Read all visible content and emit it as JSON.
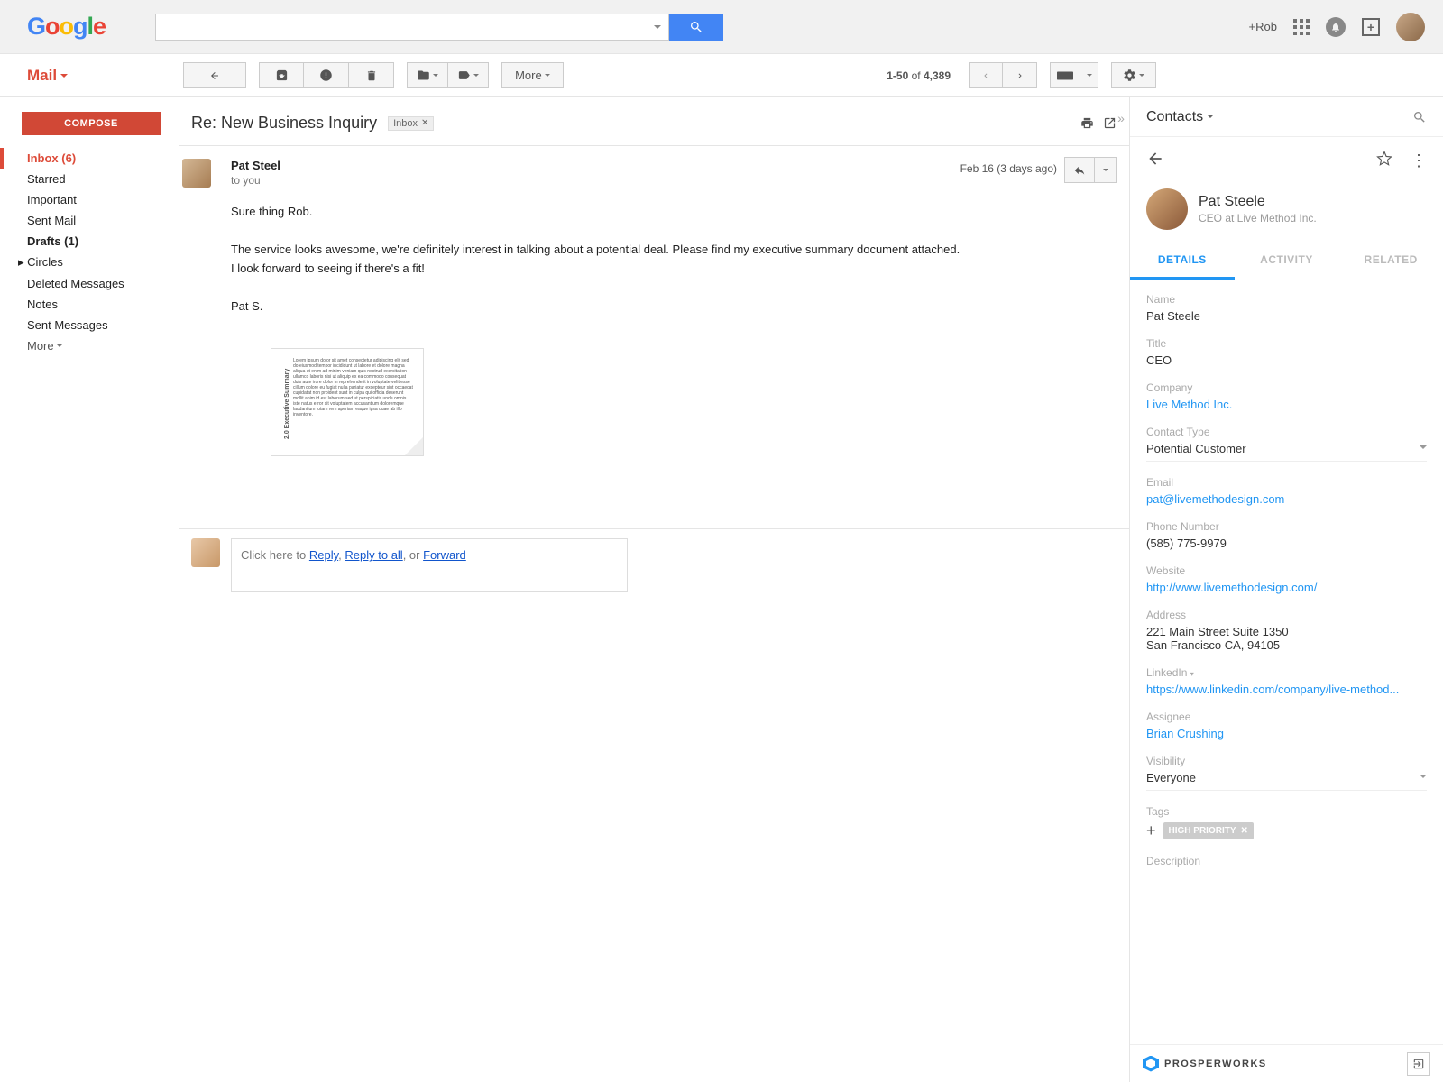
{
  "header": {
    "logo_text": "Google",
    "plus_user": "+Rob"
  },
  "mail": {
    "label": "Mail",
    "compose": "COMPOSE",
    "more_label": "More",
    "pagination_range": "1-50",
    "pagination_of": "of",
    "pagination_total": "4,389"
  },
  "sidebar": [
    {
      "label": "Inbox (6)",
      "active": true
    },
    {
      "label": "Starred"
    },
    {
      "label": "Important"
    },
    {
      "label": "Sent Mail"
    },
    {
      "label": "Drafts (1)",
      "bold": true
    },
    {
      "label": "Circles",
      "expandable": true
    },
    {
      "label": "Deleted Messages"
    },
    {
      "label": "Notes"
    },
    {
      "label": "Sent Messages"
    }
  ],
  "sidebar_more": "More",
  "email": {
    "subject": "Re: New Business Inquiry",
    "tag": "Inbox",
    "from": "Pat Steel",
    "to": "to you",
    "date": "Feb 16 (3 days ago)",
    "body1": "Sure thing Rob.",
    "body2": "The service looks awesome, we're definitely interest in talking about a potential deal. Please find my executive summary document attached.",
    "body3": "I look forward to seeing if there's a fit!",
    "sig": "Pat S.",
    "attachment_title": "2.0 Executive Summary"
  },
  "reply": {
    "prefix": "Click here to ",
    "reply": "Reply",
    "sep1": ", ",
    "reply_all": "Reply to all",
    "sep2": ", or ",
    "forward": "Forward"
  },
  "panel": {
    "title": "Contacts",
    "contact_name": "Pat Steele",
    "contact_sub": "CEO at Live Method Inc.",
    "tabs": [
      "DETAILS",
      "ACTIVITY",
      "RELATED"
    ],
    "fields": {
      "name_label": "Name",
      "name_value": "Pat Steele",
      "title_label": "Title",
      "title_value": "CEO",
      "company_label": "Company",
      "company_value": "Live Method Inc.",
      "ctype_label": "Contact Type",
      "ctype_value": "Potential Customer",
      "email_label": "Email",
      "email_value": "pat@livemethodesign.com",
      "phone_label": "Phone Number",
      "phone_value": "(585) 775-9979",
      "website_label": "Website",
      "website_value": "http://www.livemethodesign.com/",
      "address_label": "Address",
      "address_line1": "221 Main Street Suite 1350",
      "address_line2": "San Francisco CA, 94105",
      "linkedin_label": "LinkedIn",
      "linkedin_value": "https://www.linkedin.com/company/live-method...",
      "assignee_label": "Assignee",
      "assignee_value": "Brian Crushing",
      "visibility_label": "Visibility",
      "visibility_value": "Everyone",
      "tags_label": "Tags",
      "tag_chip": "HIGH PRIORITY",
      "description_label": "Description"
    },
    "brand": "PROSPERWORKS"
  }
}
